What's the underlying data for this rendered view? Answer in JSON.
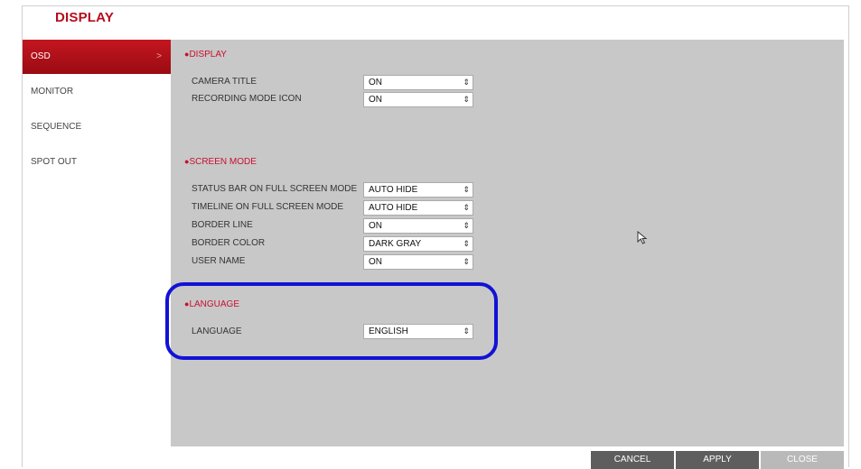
{
  "header": {
    "title": "DISPLAY"
  },
  "sidebar": {
    "items": [
      {
        "label": "OSD",
        "active": true,
        "chevron": ">"
      },
      {
        "label": "MONITOR"
      },
      {
        "label": "SEQUENCE"
      },
      {
        "label": "SPOT OUT"
      }
    ]
  },
  "sections": {
    "display": {
      "title": "DISPLAY",
      "rows": [
        {
          "label": "CAMERA TITLE",
          "value": "ON"
        },
        {
          "label": "RECORDING MODE ICON",
          "value": "ON"
        }
      ]
    },
    "screen_mode": {
      "title": "SCREEN MODE",
      "rows": [
        {
          "label": "STATUS BAR ON FULL SCREEN MODE",
          "value": "AUTO HIDE"
        },
        {
          "label": "TIMELINE ON FULL SCREEN MODE",
          "value": "AUTO HIDE"
        },
        {
          "label": "BORDER LINE",
          "value": "ON"
        },
        {
          "label": "BORDER COLOR",
          "value": "DARK GRAY"
        },
        {
          "label": "USER NAME",
          "value": "ON"
        }
      ]
    },
    "language": {
      "title": "LANGUAGE",
      "rows": [
        {
          "label": "LANGUAGE",
          "value": "ENGLISH"
        }
      ]
    }
  },
  "bullet": "●",
  "select_arrow": "⇕",
  "buttons": {
    "cancel": "CANCEL",
    "apply": "APPLY",
    "close": "CLOSE"
  },
  "colors": {
    "accent": "#c8102e",
    "title": "#b70d1c",
    "panel": "#c8c8c8",
    "highlight": "#1212d6",
    "button": "#5e5e5e"
  }
}
